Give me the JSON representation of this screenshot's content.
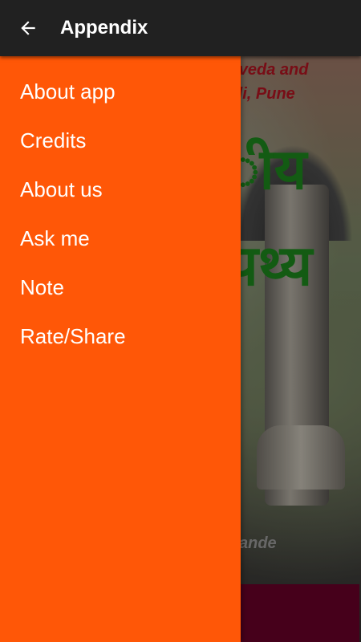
{
  "app_bar": {
    "title": "Appendix",
    "back_icon": "arrow-back-icon"
  },
  "drawer": {
    "background": "#ff5707",
    "items": [
      {
        "label": "About app"
      },
      {
        "label": "Credits"
      },
      {
        "label": "About us"
      },
      {
        "label": "Ask me"
      },
      {
        "label": "Note"
      },
      {
        "label": "Rate/Share"
      }
    ]
  },
  "background": {
    "caption_line1": "rveda and",
    "caption_line2": "di, Pune",
    "hindi_line1": "ीय",
    "hindi_line2": "पथ्य",
    "author": "ande"
  }
}
